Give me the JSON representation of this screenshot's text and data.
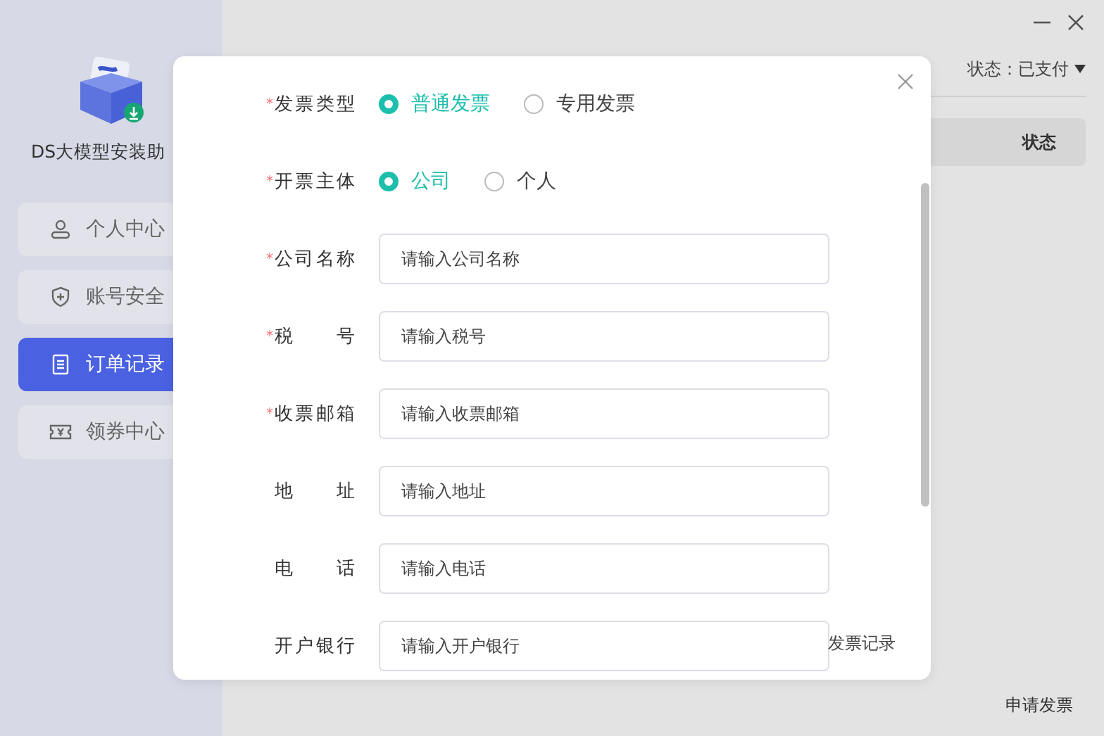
{
  "sidebar": {
    "app_name": "DS大模型安装助",
    "items": [
      {
        "label": "个人中心",
        "selected": false
      },
      {
        "label": "账号安全",
        "selected": false
      },
      {
        "label": "订单记录",
        "selected": true
      },
      {
        "label": "领券中心",
        "selected": false
      }
    ]
  },
  "main": {
    "filter": {
      "label": "状态：",
      "value": "已支付"
    },
    "table": {
      "columns": [
        "状态"
      ]
    },
    "link": "发票记录",
    "apply_button": "申请发票"
  },
  "dialog": {
    "required_mark": "*",
    "fields": [
      {
        "kind": "radio",
        "label": "发票类型",
        "required": true,
        "options": [
          {
            "label": "普通发票",
            "selected": true
          },
          {
            "label": "专用发票",
            "selected": false
          }
        ]
      },
      {
        "kind": "radio",
        "label": "开票主体",
        "required": true,
        "options": [
          {
            "label": "公司",
            "selected": true
          },
          {
            "label": "个人",
            "selected": false
          }
        ]
      },
      {
        "kind": "input",
        "label": "公司名称",
        "required": true,
        "placeholder": "请输入公司名称"
      },
      {
        "kind": "input",
        "label": "税号",
        "required": true,
        "placeholder": "请输入税号"
      },
      {
        "kind": "input",
        "label": "收票邮箱",
        "required": true,
        "placeholder": "请输入收票邮箱"
      },
      {
        "kind": "input",
        "label": "地址",
        "required": false,
        "placeholder": "请输入地址"
      },
      {
        "kind": "input",
        "label": "电话",
        "required": false,
        "placeholder": "请输入电话"
      },
      {
        "kind": "input",
        "label": "开户银行",
        "required": false,
        "placeholder": "请输入开户银行"
      }
    ]
  }
}
